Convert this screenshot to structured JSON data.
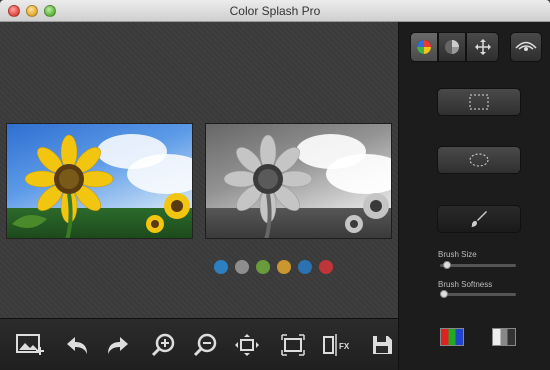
{
  "window": {
    "title": "Color Splash Pro"
  },
  "canvas": {
    "swatches": [
      "#2c7fc1",
      "#8e8e8e",
      "#6a9b3b",
      "#c9962f",
      "#2c72b0",
      "#c0353a"
    ]
  },
  "toolbar": {
    "items": [
      "add-image-icon",
      "undo-icon",
      "redo-icon",
      "zoom-in-icon",
      "zoom-out-icon",
      "fit-screen-icon",
      "actual-size-icon",
      "compare-fx-icon",
      "save-icon"
    ],
    "fx_label": "FX"
  },
  "panel": {
    "tabs": [
      "color-wheel-icon",
      "gray-circle-icon",
      "move-arrows-icon",
      "eye-icon"
    ],
    "brush_size_label": "Brush Size",
    "brush_softness_label": "Brush Softness",
    "brush_size_value": 0.05,
    "brush_softness_value": 0.0
  }
}
